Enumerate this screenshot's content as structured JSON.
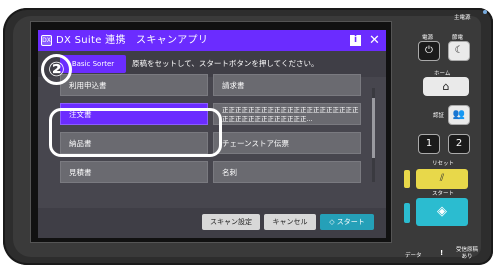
{
  "app": {
    "logo_text": "DX",
    "title": "DX Suite 連携　スキャンアプリ",
    "info_label": "i",
    "close_label": "✕"
  },
  "subheader": {
    "sorter_label": "Basic Sorter",
    "instruction": "原稿をセットして、スタートボタンを押してください。"
  },
  "documents": [
    "利用申込書",
    "請求書",
    "注文書",
    "正正正正正正正正正正正正正正正正正正正正正正正正正正正正正正正正正正...",
    "納品書",
    "チェーンストア伝票",
    "見積書",
    "名刺"
  ],
  "selected_document": "注文書",
  "scroll_position": 0.3,
  "bottom": {
    "scan_settings": "スキャン設定",
    "cancel": "キャンセル",
    "start": "スタート"
  },
  "overlay": {
    "step_number": "②"
  },
  "panel": {
    "main_power": "主電源",
    "power_label": "電源",
    "power_save_label": "節電",
    "home_label": "ホーム",
    "auth_label": "認証",
    "key1": "1",
    "key2": "2",
    "reset_label": "リセット",
    "start_label": "スタート",
    "data_label": "データ",
    "alert_label": "!",
    "fax_label": "受信原稿\nあり"
  },
  "colors": {
    "accent": "#6b2cff",
    "start": "#25a0b8",
    "reset": "#e8d84a"
  }
}
